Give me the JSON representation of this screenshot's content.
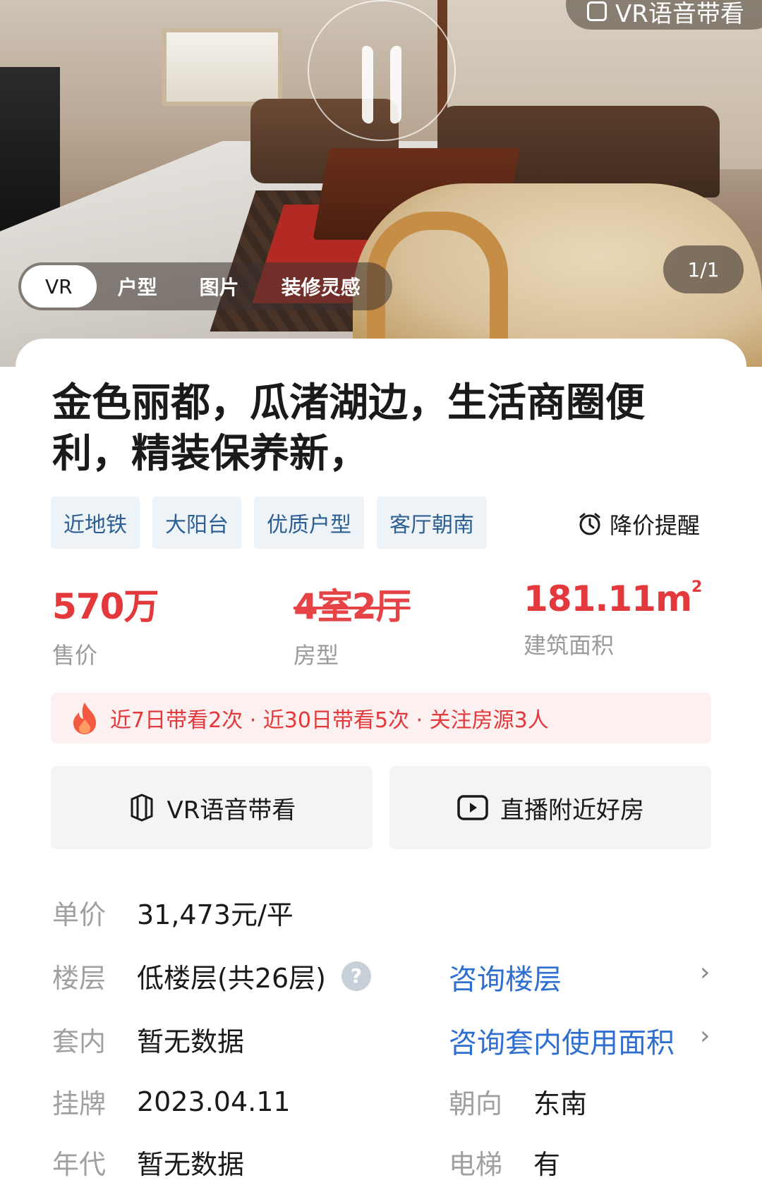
{
  "hero": {
    "top_vr_label": "VR语音带看",
    "tabs": [
      {
        "label": "VR",
        "active": true
      },
      {
        "label": "户型",
        "active": false
      },
      {
        "label": "图片",
        "active": false
      },
      {
        "label": "装修灵感",
        "active": false
      }
    ],
    "counter": "1/1"
  },
  "listing": {
    "title": "金色丽都，瓜渚湖边，生活商圈便利，精装保养新，",
    "tags": [
      "近地铁",
      "大阳台",
      "优质户型",
      "客厅朝南"
    ],
    "price_alert": "降价提醒",
    "stats": {
      "price_value": "570万",
      "price_label": "售价",
      "layout_value": "4室2厅",
      "layout_label": "房型",
      "area_value": "181.11m",
      "area_unit_sup": "2",
      "area_label": "建筑面积"
    },
    "heat": "近7日带看2次 · 近30日带看5次 · 关注房源3人",
    "actions": {
      "vr_voice": "VR语音带看",
      "live": "直播附近好房"
    },
    "details": {
      "unit_price_key": "单价",
      "unit_price_value": "31,473元/平",
      "floor_key": "楼层",
      "floor_value": "低楼层(共26层)",
      "floor_consult": "咨询楼层",
      "inner_key": "套内",
      "inner_value": "暂无数据",
      "inner_consult": "咨询套内使用面积",
      "listed_key": "挂牌",
      "listed_value": "2023.04.11",
      "orientation_key": "朝向",
      "orientation_value": "东南",
      "year_key": "年代",
      "year_value": "暂无数据",
      "elevator_key": "电梯",
      "elevator_value": "有"
    }
  },
  "colors": {
    "accent_red": "#e4393c",
    "link_blue": "#2f6fd0",
    "tag_text": "#2d5f93",
    "tag_bg": "#eef3f8"
  },
  "icons": {
    "help": "?",
    "chevron": "›"
  }
}
